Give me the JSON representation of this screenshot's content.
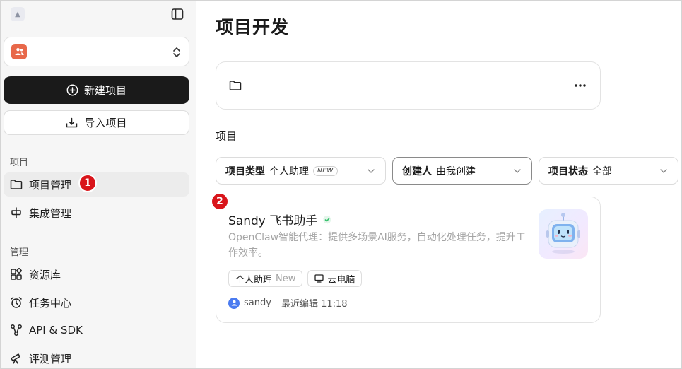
{
  "colors": {
    "primary_button": "#1a1a1a",
    "badge": "#d9151b",
    "verified": "#34c06a",
    "space_avatar": "#e8684a",
    "user_avatar": "#4a7bf0"
  },
  "sidebar": {
    "new_project": {
      "label": "新建项目",
      "icon": "plus-circle-icon"
    },
    "import_project": {
      "label": "导入项目",
      "icon": "import-tray-icon"
    },
    "section_projects": "项目",
    "project_items": [
      {
        "label": "项目管理",
        "icon": "folder-icon",
        "badge": "1"
      },
      {
        "label": "集成管理",
        "icon": "integration-icon"
      }
    ],
    "section_manage": "管理",
    "manage_items": [
      {
        "label": "资源库",
        "icon": "grid-icon"
      },
      {
        "label": "任务中心",
        "icon": "alarm-clock-icon"
      },
      {
        "label": "API & SDK",
        "icon": "nodes-icon"
      },
      {
        "label": "评测管理",
        "icon": "telescope-icon"
      }
    ]
  },
  "main": {
    "title": "项目开发",
    "section_title": "项目",
    "filters": [
      {
        "label": "项目类型",
        "value": "个人助理",
        "tag": "NEW"
      },
      {
        "label": "创建人",
        "value": "由我创建"
      },
      {
        "label": "项目状态",
        "value": "全部"
      }
    ],
    "card": {
      "badge": "2",
      "title": "Sandy 飞书助手",
      "description": "OpenClaw智能代理：提供多场景AI服务，自动化处理任务，提升工作效率。",
      "tags": [
        {
          "label": "个人助理",
          "extra": "New"
        },
        {
          "label": "云电脑",
          "icon": "monitor-icon"
        }
      ],
      "author": "sandy",
      "edited": "最近编辑 11:18"
    }
  }
}
